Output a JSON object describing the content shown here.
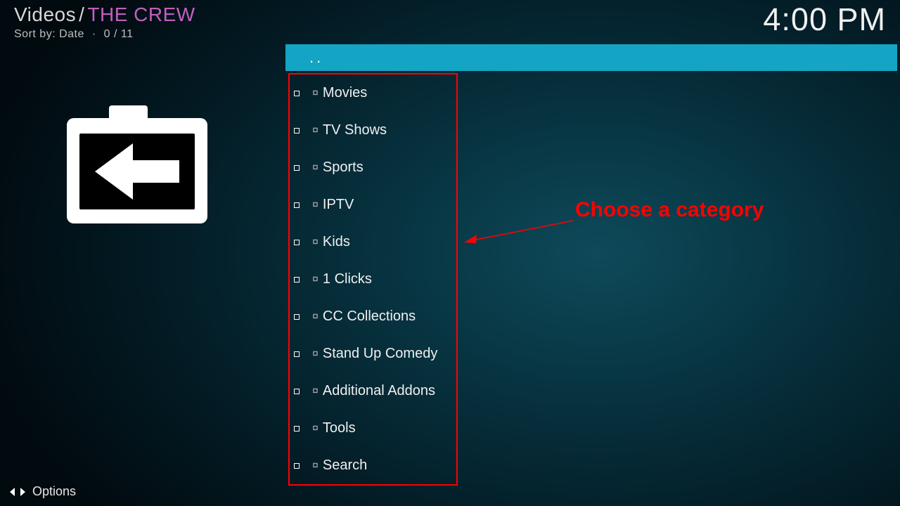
{
  "header": {
    "breadcrumb_root": "Videos",
    "breadcrumb_leaf": "THE CREW",
    "sort_label": "Sort by:",
    "sort_value": "Date",
    "position": "0 / 11"
  },
  "clock": "4:00 PM",
  "parent_item": "..",
  "list": {
    "marker": "¤",
    "items": [
      "Movies",
      "TV Shows",
      "Sports",
      "IPTV",
      "Kids",
      "1 Clicks",
      "CC Collections",
      "Stand Up Comedy",
      "Additional Addons",
      "Tools",
      "Search"
    ]
  },
  "annotation": {
    "text": "Choose a category"
  },
  "footer": {
    "options": "Options"
  }
}
